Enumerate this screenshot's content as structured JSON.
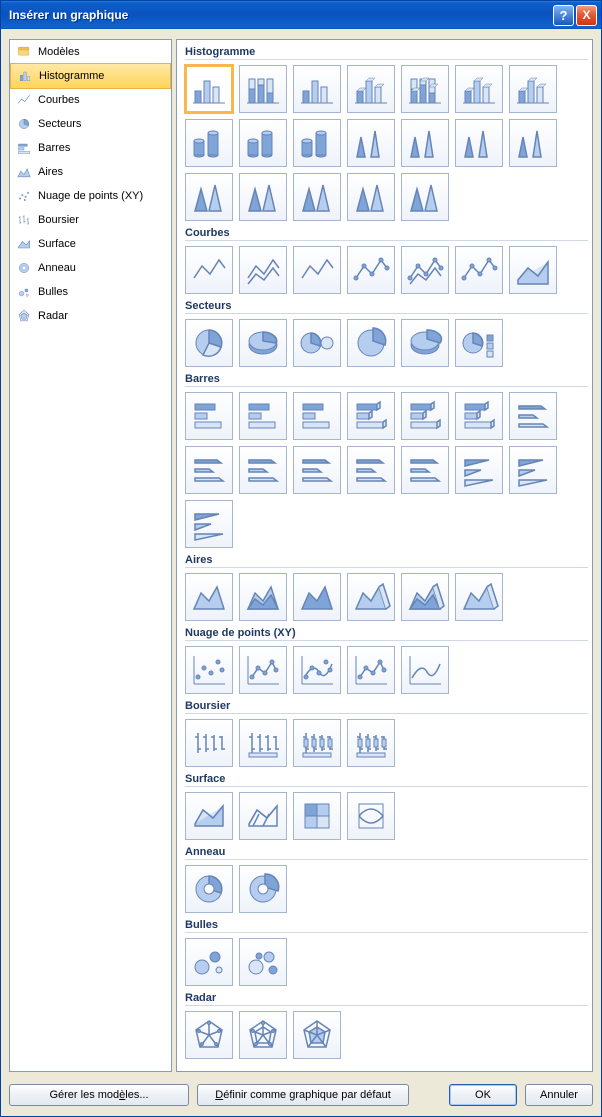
{
  "window": {
    "title": "Insérer un graphique"
  },
  "sidebar": {
    "items": [
      {
        "id": "templates",
        "label": "Modèles",
        "selected": false
      },
      {
        "id": "column",
        "label": "Histogramme",
        "selected": true
      },
      {
        "id": "line",
        "label": "Courbes",
        "selected": false
      },
      {
        "id": "pie",
        "label": "Secteurs",
        "selected": false
      },
      {
        "id": "bar",
        "label": "Barres",
        "selected": false
      },
      {
        "id": "area",
        "label": "Aires",
        "selected": false
      },
      {
        "id": "xyscatter",
        "label": "Nuage de points (XY)",
        "selected": false
      },
      {
        "id": "stock",
        "label": "Boursier",
        "selected": false
      },
      {
        "id": "surface",
        "label": "Surface",
        "selected": false
      },
      {
        "id": "doughnut",
        "label": "Anneau",
        "selected": false
      },
      {
        "id": "bubble",
        "label": "Bulles",
        "selected": false
      },
      {
        "id": "radar",
        "label": "Radar",
        "selected": false
      }
    ]
  },
  "categories": [
    {
      "id": "column",
      "heading": "Histogramme",
      "count": 19,
      "selected_index": 0
    },
    {
      "id": "line",
      "heading": "Courbes",
      "count": 7
    },
    {
      "id": "pie",
      "heading": "Secteurs",
      "count": 6
    },
    {
      "id": "bar",
      "heading": "Barres",
      "count": 15
    },
    {
      "id": "area",
      "heading": "Aires",
      "count": 6
    },
    {
      "id": "xyscatter",
      "heading": "Nuage de points (XY)",
      "count": 5
    },
    {
      "id": "stock",
      "heading": "Boursier",
      "count": 4
    },
    {
      "id": "surface",
      "heading": "Surface",
      "count": 4
    },
    {
      "id": "doughnut",
      "heading": "Anneau",
      "count": 2
    },
    {
      "id": "bubble",
      "heading": "Bulles",
      "count": 2
    },
    {
      "id": "radar",
      "heading": "Radar",
      "count": 3
    }
  ],
  "footer": {
    "manage_templates": "Gérer les modèles...",
    "manage_templates_underline_index": 13,
    "set_default": "Définir comme graphique par défaut",
    "set_default_underline_index": 0,
    "ok": "OK",
    "cancel": "Annuler"
  },
  "titlebar_buttons": {
    "help": "?",
    "close": "X"
  }
}
